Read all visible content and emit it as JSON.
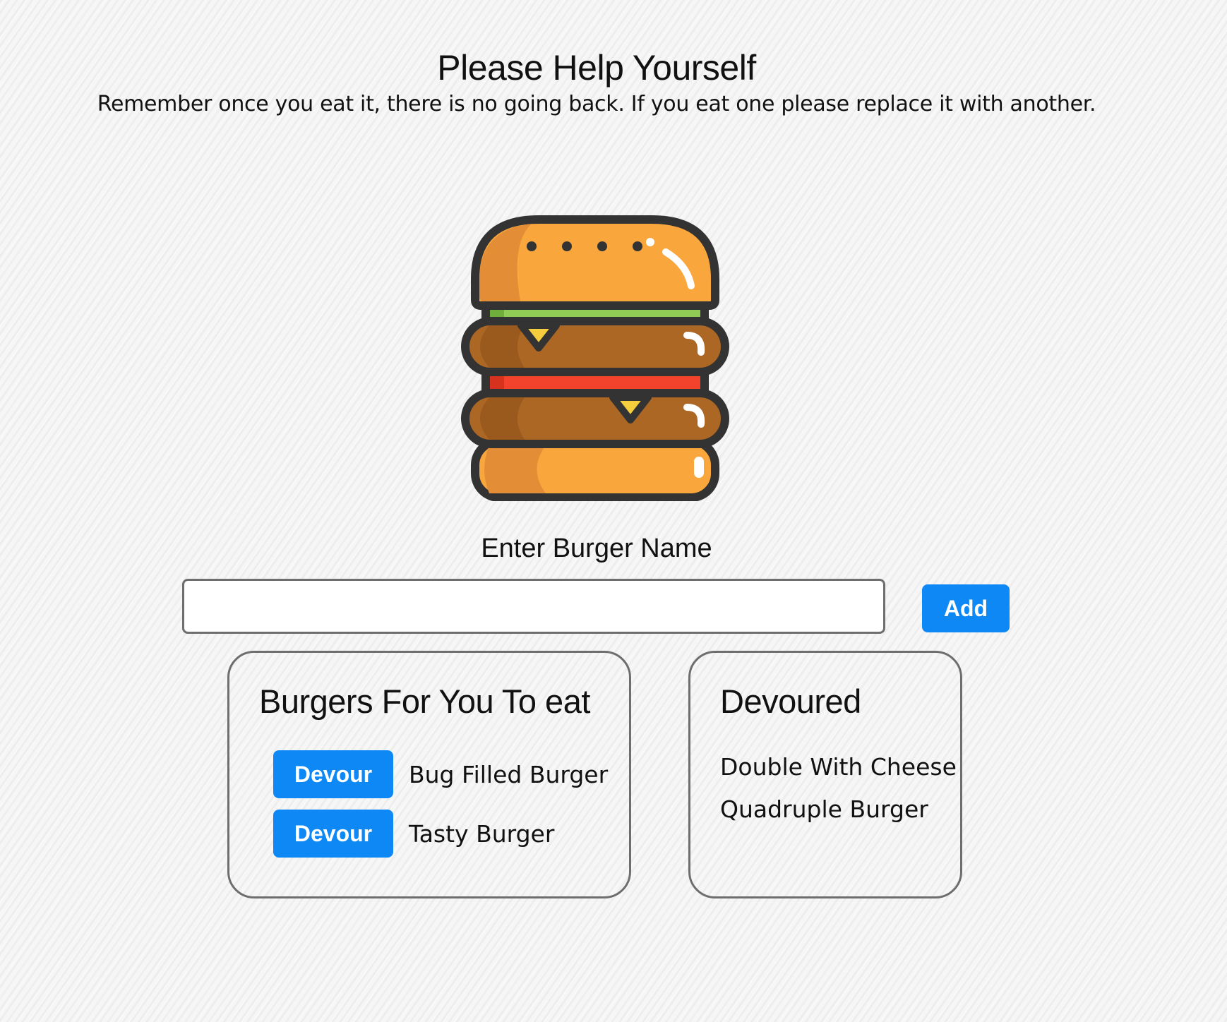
{
  "header": {
    "title": "Please Help Yourself",
    "subtitle": "Remember once you eat it, there is no going back. If you eat one please replace it with another."
  },
  "hero": {
    "icon": "burger-icon"
  },
  "form": {
    "label": "Enter Burger Name",
    "input_value": "",
    "input_placeholder": "",
    "add_label": "Add"
  },
  "uneaten": {
    "heading": "Burgers For You To eat",
    "items": [
      {
        "name": "Bug Filled Burger",
        "button_label": "Devour"
      },
      {
        "name": "Tasty Burger",
        "button_label": "Devour"
      }
    ]
  },
  "devoured": {
    "heading": "Devoured",
    "items": [
      {
        "name": "Double With Cheese"
      },
      {
        "name": "Quadruple Burger"
      }
    ]
  },
  "colors": {
    "button": "#0d88f5",
    "panel_border": "#6e6e6e",
    "bun": "#f9a63c",
    "bun_shadow": "#e38e36",
    "patty": "#ad6724",
    "lettuce": "#8fcb55",
    "tomato": "#f3432c",
    "cheese": "#f6ce3d",
    "outline": "#333333"
  }
}
